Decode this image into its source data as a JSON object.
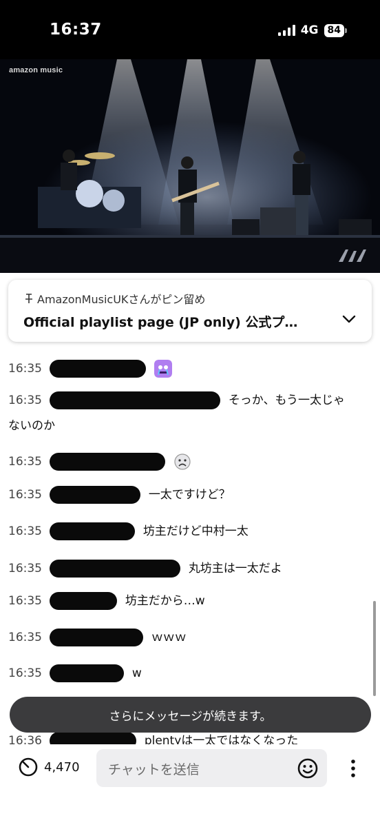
{
  "status_bar": {
    "time": "16:37",
    "network": "4G",
    "battery": "84"
  },
  "video": {
    "brand": "amazon music"
  },
  "pinned": {
    "pinned_by": "AmazonMusicUKさんがピン留め",
    "title": "Official playlist page (JP only) 公式プ…"
  },
  "messages": [
    {
      "time": "16:35",
      "text": ""
    },
    {
      "time": "16:35",
      "text": "そっか、もう一太じゃ",
      "text2": "ないのか"
    },
    {
      "time": "16:35",
      "text": ""
    },
    {
      "time": "16:35",
      "text": "一太ですけど？"
    },
    {
      "time": "16:35",
      "text": "坊主だけど中村一太"
    },
    {
      "time": "16:35",
      "text": "丸坊主は一太だよ"
    },
    {
      "time": "16:35",
      "text": "坊主だから…w"
    },
    {
      "time": "16:35",
      "text": "ｗｗｗ"
    },
    {
      "time": "16:35",
      "text": "w"
    },
    {
      "time": "16:36",
      "text": "plentyは一太ではなくなった"
    }
  ],
  "more_messages_banner": "さらにメッセージが続きます。",
  "bottom_bar": {
    "viewer_count": "4,470",
    "chat_placeholder": "チャットを送信"
  },
  "colors": {
    "accent": "#4a90e2",
    "banner_bg": "#3b3b3d"
  }
}
